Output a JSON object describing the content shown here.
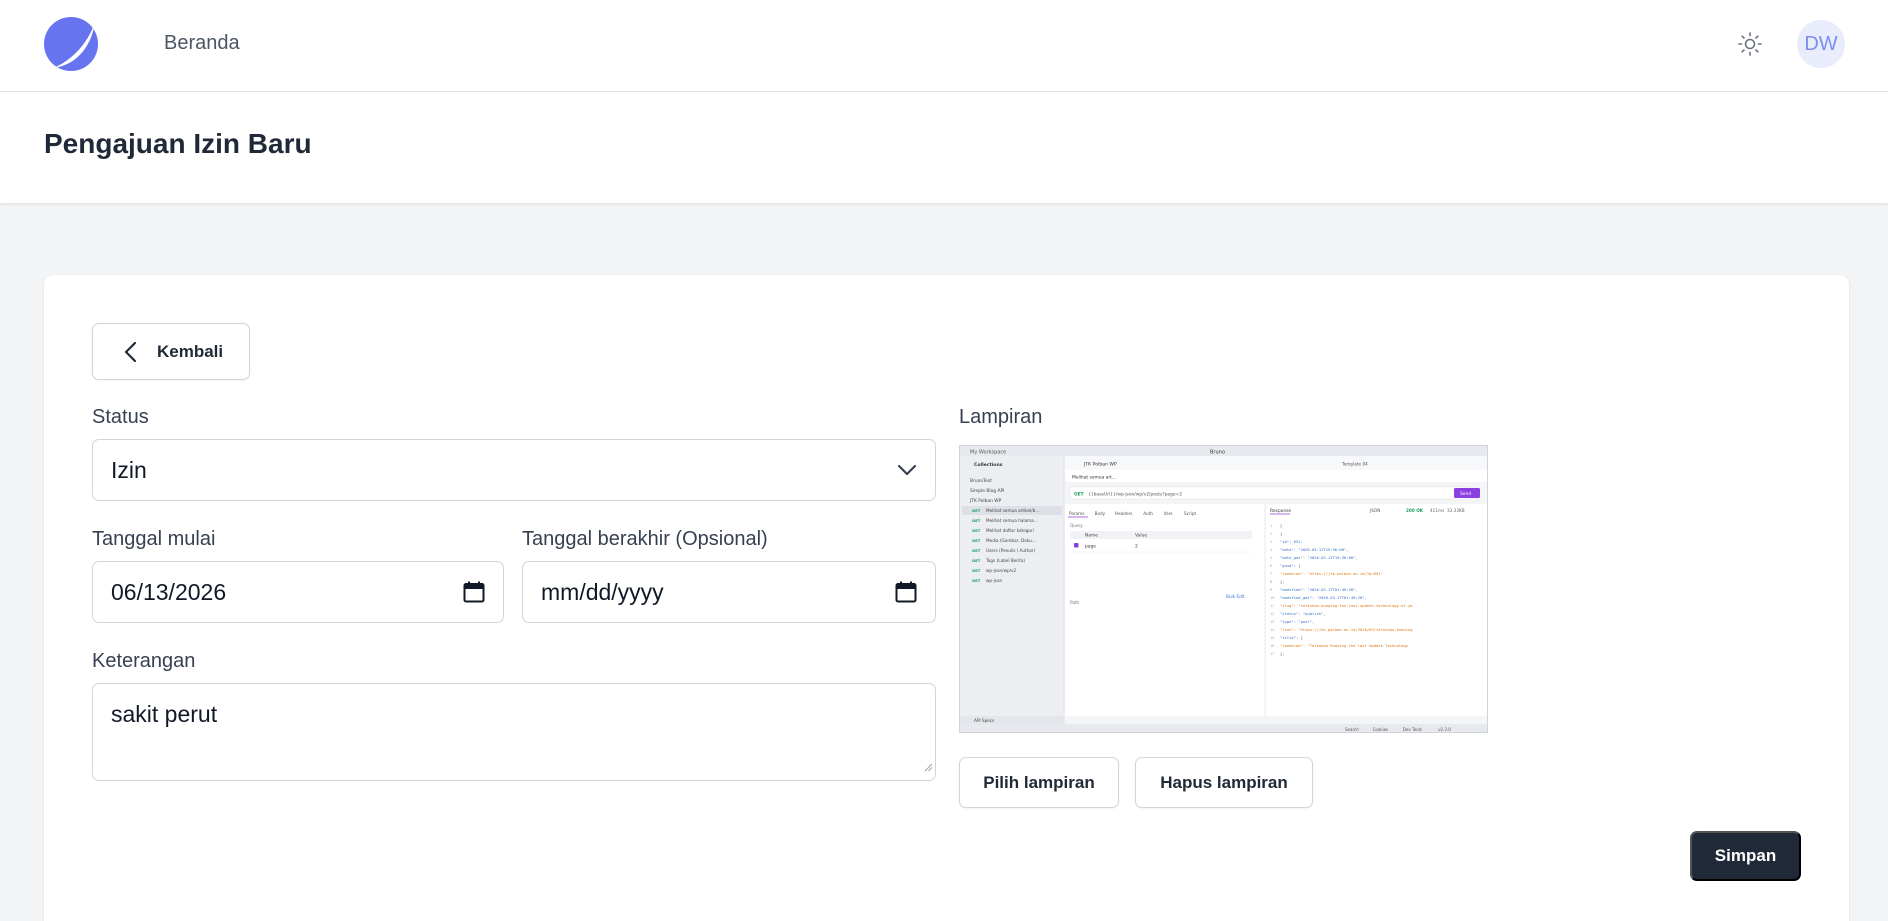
{
  "nav": {
    "home_label": "Beranda",
    "avatar_initials": "DW",
    "logo_color": "#6674f0"
  },
  "page": {
    "title": "Pengajuan Izin Baru"
  },
  "form": {
    "back_label": "Kembali",
    "status_label": "Status",
    "status_value": "Izin",
    "start_date_label": "Tanggal mulai",
    "start_date_value": "06/13/2026",
    "end_date_label": "Tanggal berakhir (Opsional)",
    "end_date_placeholder": "mm/dd/yyyy",
    "notes_label": "Keterangan",
    "notes_value": "sakit perut",
    "attachment_label": "Lampiran",
    "choose_attachment_label": "Pilih lampiran",
    "remove_attachment_label": "Hapus lampiran",
    "save_label": "Simpan"
  },
  "attachment_preview": {
    "app_title": "Bruno",
    "workspace": "My Workspace",
    "collections_label": "Collections",
    "collections": [
      "BrunoTest",
      "Simple Blog API",
      "JTK Polban WP"
    ],
    "requests": [
      {
        "method": "GET",
        "name": "Melihat semua artikel/b..."
      },
      {
        "method": "GET",
        "name": "Melihat semua halama..."
      },
      {
        "method": "GET",
        "name": "Melihat daftar kategori"
      },
      {
        "method": "GET",
        "name": "Media (Gambar, Doku..."
      },
      {
        "method": "GET",
        "name": "Users (Penulis / Author)"
      },
      {
        "method": "GET",
        "name": "Tags (Label Berita)"
      },
      {
        "method": "GET",
        "name": "wp-json/wp/v2"
      },
      {
        "method": "GET",
        "name": "wp-json"
      }
    ],
    "tab_collection": "JTK Polban WP",
    "tab_request": "Melihat semua art...",
    "url": "{{baseUrl}}/wp-json/wp/v2/posts?page=2",
    "send_label": "Send",
    "req_tabs": [
      "Params",
      "Body",
      "Headers",
      "Auth",
      "Vars",
      "Script"
    ],
    "query_label": "Query",
    "param_headers": [
      "Name",
      "Value"
    ],
    "param_row": [
      "page",
      "2"
    ],
    "bulk_edit": "Bulk Edit",
    "path_label": "Path",
    "resp_tab": "Response",
    "resp_format": "JSON",
    "resp_status": "200 OK",
    "resp_time": "411ms",
    "resp_size": "33.33KB",
    "env_label": "Template 04",
    "api_spec_label": "API Specs",
    "footer_items": [
      "Search",
      "Cookies",
      "Dev Tools",
      "v2.3.0"
    ],
    "json_lines": [
      "[",
      "  {",
      "    \"id\": 651,",
      "    \"date\": \"2026-03-11T19:36:00\",",
      "    \"date_gmt\": \"2026-03-11T19:36:00\",",
      "    \"guid\": {",
      "      \"rendered\": \"https://jtk.polban.ac.id/?p=651\"",
      "    },",
      "    \"modified\": \"2026-03-17T01:49:28\",",
      "    \"modified_gmt\": \"2026-03-17T01:49:28\",",
      "    \"slug\": \"talkshow-knowing-the-last-update-technology-of-your-hardware-hardware-hilic-di-polban\",",
      "    \"status\": \"publish\",",
      "    \"type\": \"post\",",
      "    \"link\": \"https://jtk.polban.ac.id/2026/03/talkshow-knowing-the-last-update-technology-of-your-hardware-hardware-hilic-di-polban/\",",
      "    \"title\": {",
      "      \"rendered\": \"Talkshow Knowing the last Update Technology of Your Hardware: Bersama Hardware Hilic di POLBAN\"",
      "    },"
    ]
  }
}
